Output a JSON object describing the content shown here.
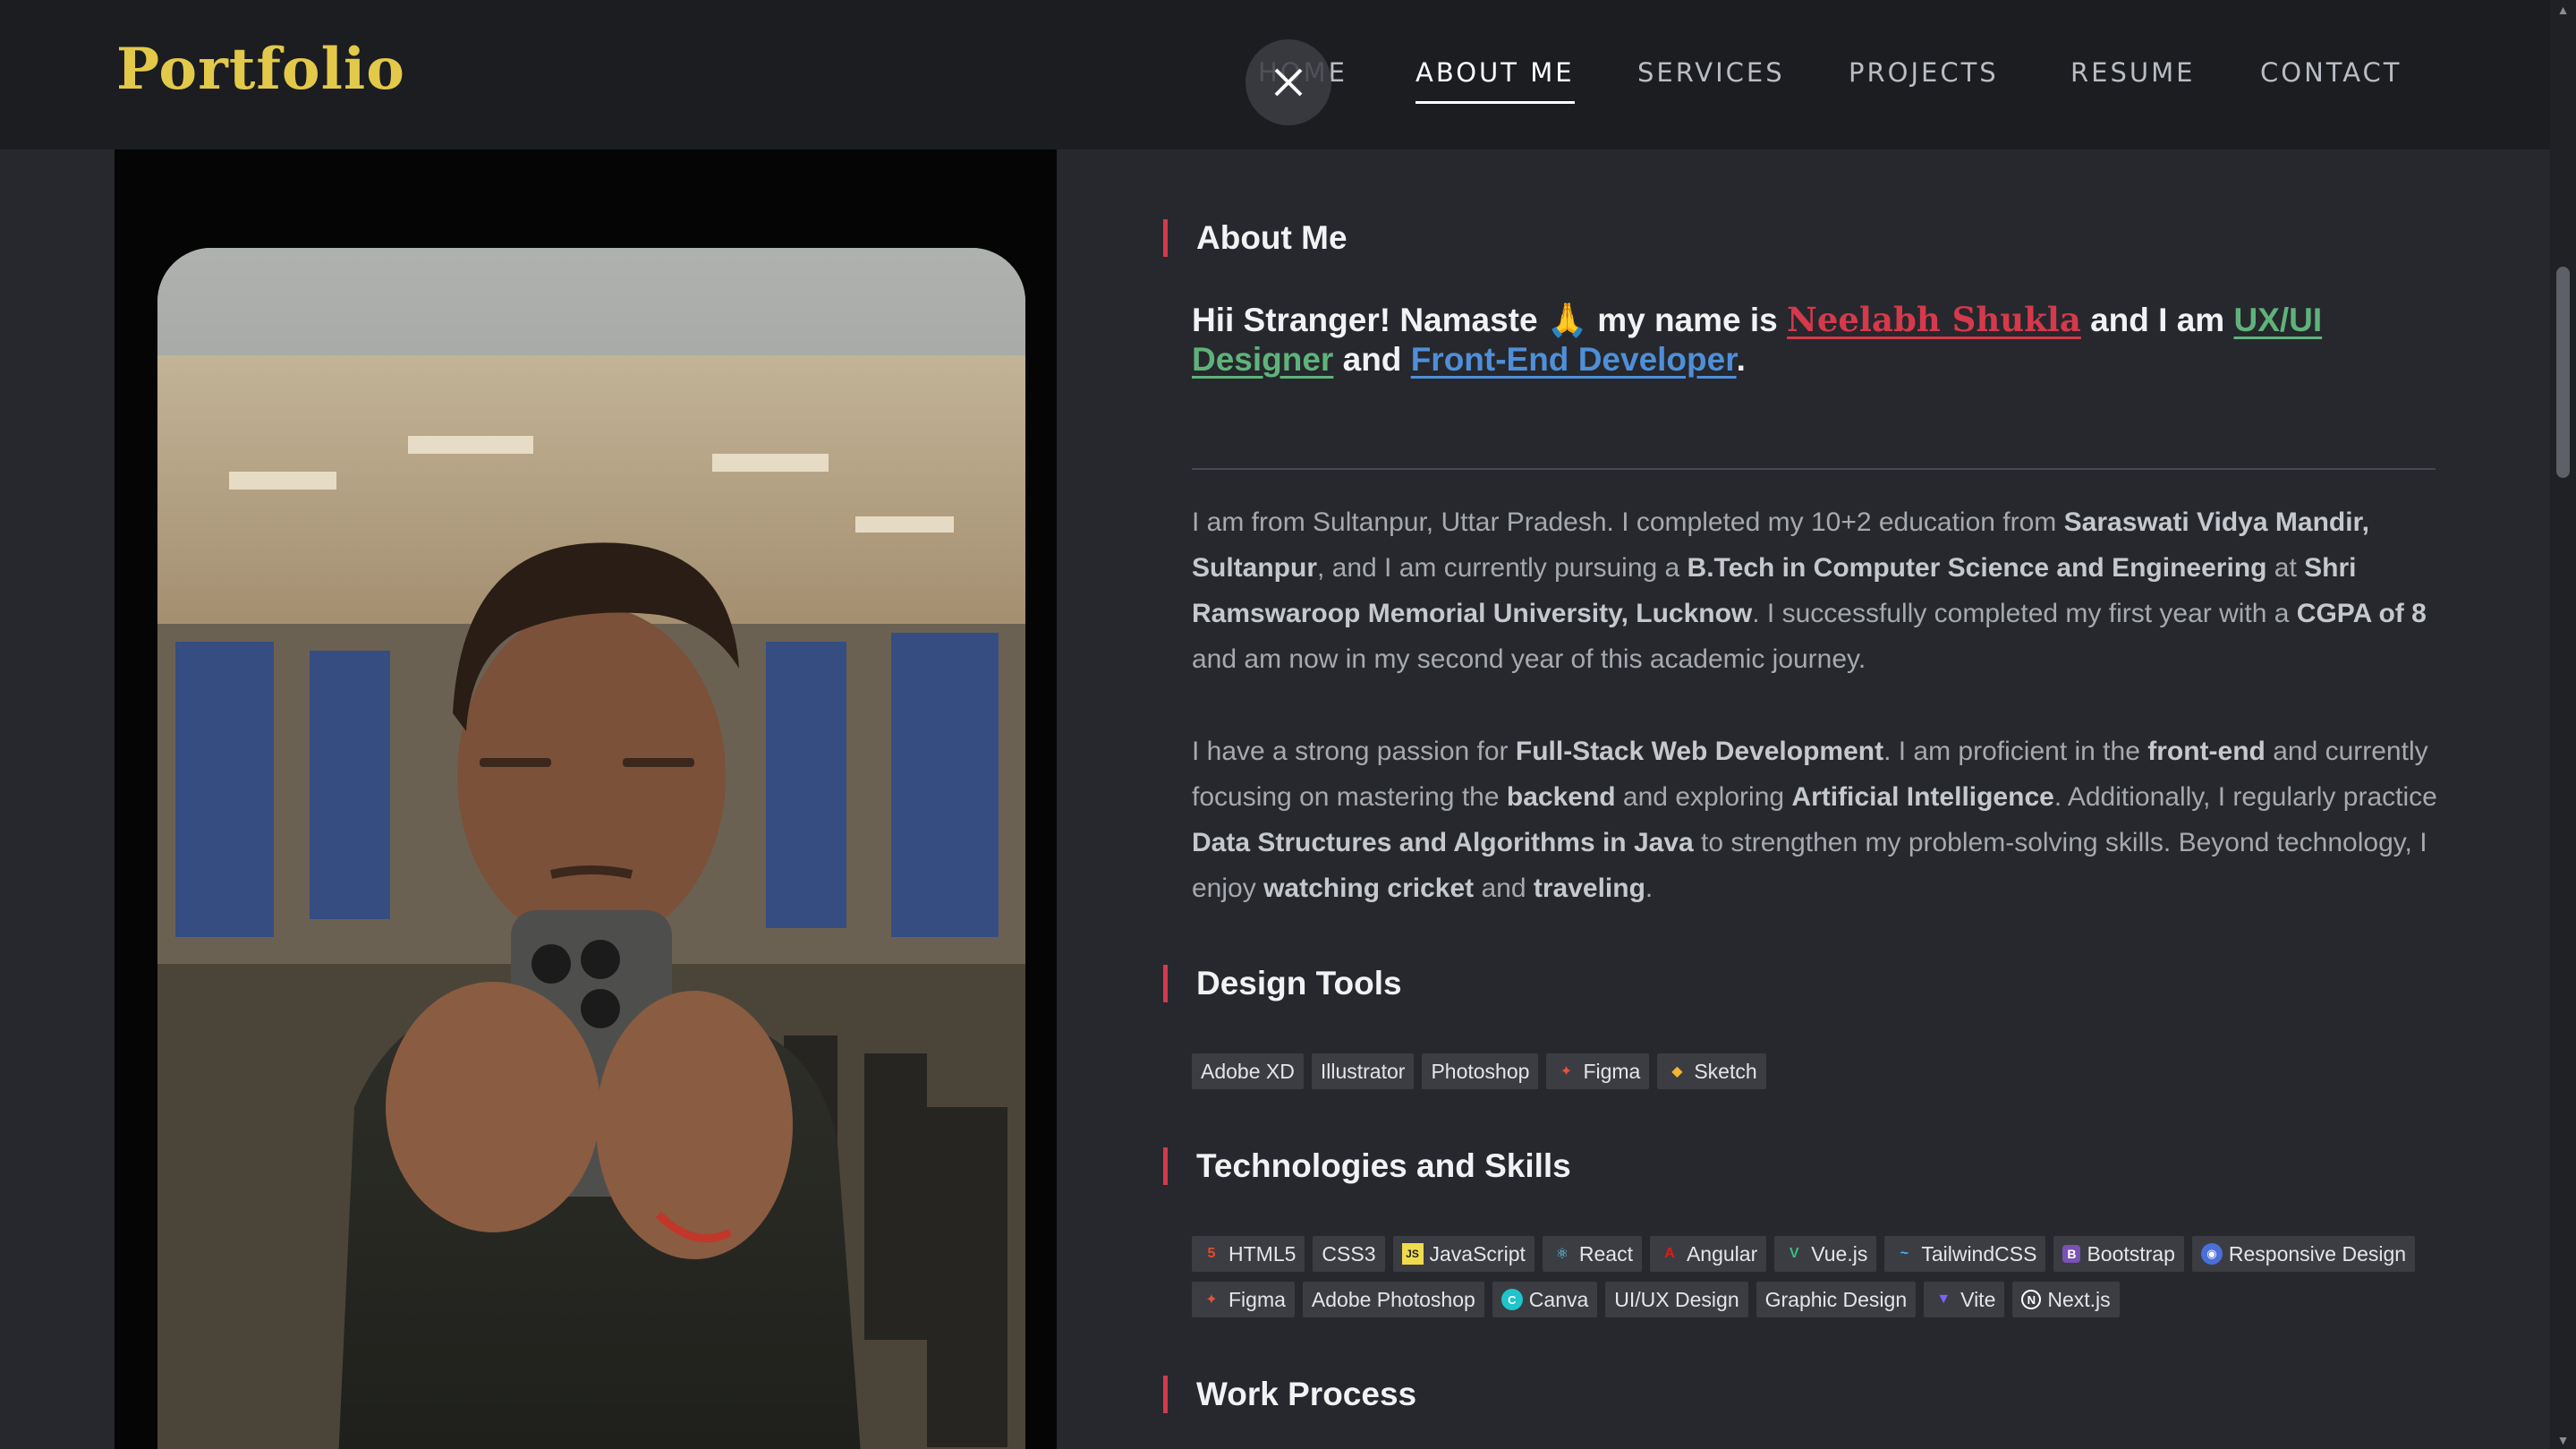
{
  "header": {
    "logo": "Portfolio",
    "nav": [
      "HOME",
      "ABOUT ME",
      "SERVICES",
      "PROJECTS",
      "RESUME",
      "CONTACT"
    ],
    "active_nav": "ABOUT ME"
  },
  "about": {
    "title": "About Me",
    "intro_greeting": "Hii Stranger!  Namaste 🙏 my name is ",
    "intro_name": "Neelabh Shukla",
    "intro_mid": " and I am ",
    "intro_role1": "UX/UI Designer",
    "intro_and": " and ",
    "intro_role2": "Front-End Developer",
    "intro_end": "."
  },
  "paragraph1": [
    [
      "t",
      "I am from Sultanpur, Uttar Pradesh. I completed my 10+2 education from "
    ],
    [
      "b",
      "Saraswati Vidya Mandir, Sultanpur"
    ],
    [
      "t",
      ", and I am currently pursuing a "
    ],
    [
      "b",
      "B.Tech in Computer Science and Engineering"
    ],
    [
      "t",
      " at "
    ],
    [
      "b",
      "Shri Ramswaroop Memorial University, Lucknow"
    ],
    [
      "t",
      ". I successfully completed my first year with a "
    ],
    [
      "b",
      "CGPA of 8"
    ],
    [
      "t",
      " and am now in my second year of this academic journey."
    ]
  ],
  "paragraph2": [
    [
      "t",
      "I have a strong passion for "
    ],
    [
      "b",
      "Full-Stack Web Development"
    ],
    [
      "t",
      ". I am proficient in the "
    ],
    [
      "b",
      "front-end"
    ],
    [
      "t",
      " and currently focusing on mastering the "
    ],
    [
      "b",
      "backend"
    ],
    [
      "t",
      " and exploring "
    ],
    [
      "b",
      "Artificial Intelligence"
    ],
    [
      "t",
      ". Additionally, I regularly practice "
    ],
    [
      "b",
      "Data Structures and Algorithms in Java"
    ],
    [
      "t",
      " to strengthen my problem-solving skills. Beyond technology, I enjoy "
    ],
    [
      "b",
      "watching cricket"
    ],
    [
      "t",
      " and "
    ],
    [
      "b",
      "traveling"
    ],
    [
      "t",
      "."
    ]
  ],
  "design_tools": {
    "title": "Design Tools",
    "items": [
      {
        "label": "Adobe XD",
        "icon": ""
      },
      {
        "label": "Illustrator",
        "icon": ""
      },
      {
        "label": "Photoshop",
        "icon": ""
      },
      {
        "label": "Figma",
        "icon": "figma-icon",
        "color": "#e2553a"
      },
      {
        "label": "Sketch",
        "icon": "sketch-icon",
        "color": "#f2b632"
      }
    ]
  },
  "skills": {
    "title": "Technologies and Skills",
    "items": [
      {
        "label": "HTML5",
        "icon": "html5-icon",
        "color": "#e44d26"
      },
      {
        "label": "CSS3",
        "icon": ""
      },
      {
        "label": "JavaScript",
        "icon": "javascript-icon",
        "color": "#f0db4f"
      },
      {
        "label": "React",
        "icon": "react-icon",
        "color": "#61dafb"
      },
      {
        "label": "Angular",
        "icon": "angular-icon",
        "color": "#dd1b16"
      },
      {
        "label": "Vue.js",
        "icon": "vue-icon",
        "color": "#41b883"
      },
      {
        "label": "TailwindCSS",
        "icon": "tailwind-icon",
        "color": "#38bdf8"
      },
      {
        "label": "Bootstrap",
        "icon": "bootstrap-icon",
        "color": "#7952b3"
      },
      {
        "label": "Responsive Design",
        "icon": "responsive-icon",
        "color": "#4a6fd8"
      },
      {
        "label": "Figma",
        "icon": "figma-icon",
        "color": "#e2553a"
      },
      {
        "label": "Adobe Photoshop",
        "icon": ""
      },
      {
        "label": "Canva",
        "icon": "canva-icon",
        "color": "#20c4cb"
      },
      {
        "label": "UI/UX Design",
        "icon": ""
      },
      {
        "label": "Graphic Design",
        "icon": ""
      },
      {
        "label": "Vite",
        "icon": "vite-icon",
        "color": "#7b61ff"
      },
      {
        "label": "Next.js",
        "icon": "nextjs-icon",
        "color": "#ffffff"
      }
    ]
  },
  "work_process": {
    "title": "Work Process"
  }
}
